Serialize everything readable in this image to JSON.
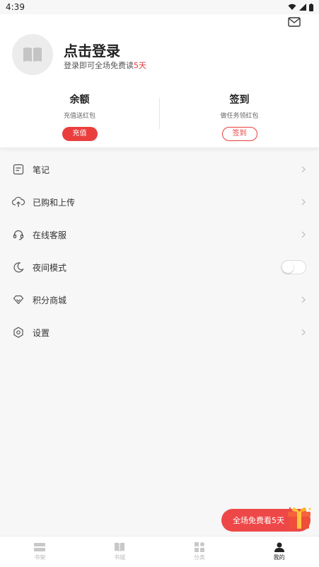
{
  "status": {
    "time": "4:39"
  },
  "profile": {
    "login_title": "点击登录",
    "login_sub_prefix": "登录即可全场免费读",
    "login_sub_highlight": "5天"
  },
  "stats": {
    "balance": {
      "title": "余额",
      "sub": "充值送红包",
      "button": "充值"
    },
    "checkin": {
      "title": "签到",
      "sub": "做任务领红包",
      "button": "签到"
    }
  },
  "menu": [
    {
      "label": "笔记",
      "icon": "note-icon"
    },
    {
      "label": "已购和上传",
      "icon": "cloud-upload-icon"
    },
    {
      "label": "在线客服",
      "icon": "headset-icon"
    },
    {
      "label": "夜间模式",
      "icon": "moon-icon",
      "toggle": false
    },
    {
      "label": "积分商城",
      "icon": "diamond-icon"
    },
    {
      "label": "设置",
      "icon": "settings-icon"
    }
  ],
  "promo": {
    "label": "全场免费看5天"
  },
  "tabs": [
    {
      "label": "书架",
      "icon": "bookshelf-icon",
      "active": false
    },
    {
      "label": "书城",
      "icon": "book-store-icon",
      "active": false
    },
    {
      "label": "分类",
      "icon": "category-icon",
      "active": false
    },
    {
      "label": "我的",
      "icon": "profile-icon",
      "active": true
    }
  ],
  "colors": {
    "accent": "#ea3e3e",
    "background": "#f7f7f7"
  }
}
